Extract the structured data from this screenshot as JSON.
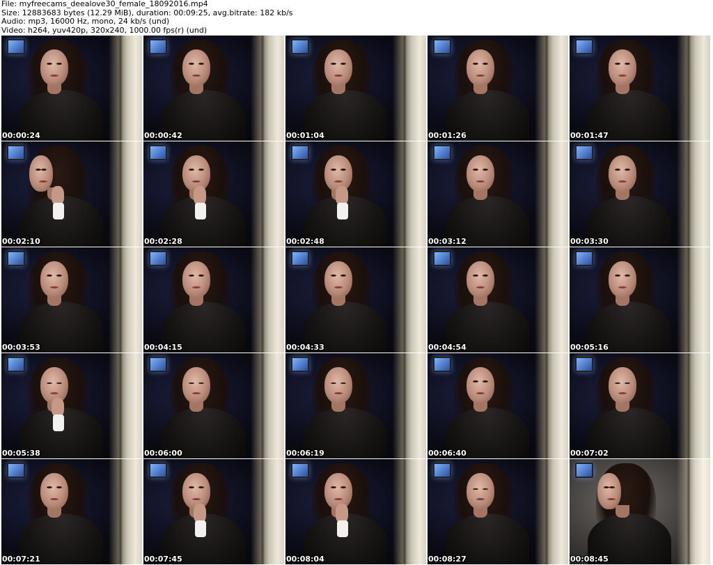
{
  "header": {
    "file": "File: myfreecams_deealove30_female_18092016.mp4",
    "size": "Size: 12883683 bytes (12.29 MiB), duration: 00:09:25, avg.bitrate: 182 kb/s",
    "audio": "Audio: mp3, 16000 Hz, mono, 24 kb/s (und)",
    "video": "Video: h264, yuv420p, 320x240, 1000.00 fps(r) (und)"
  },
  "thumbnails": [
    {
      "time": "00:00:24"
    },
    {
      "time": "00:00:42"
    },
    {
      "time": "00:01:04"
    },
    {
      "time": "00:01:26"
    },
    {
      "time": "00:01:47"
    },
    {
      "time": "00:02:10"
    },
    {
      "time": "00:02:28"
    },
    {
      "time": "00:02:48"
    },
    {
      "time": "00:03:12"
    },
    {
      "time": "00:03:30"
    },
    {
      "time": "00:03:53"
    },
    {
      "time": "00:04:15"
    },
    {
      "time": "00:04:33"
    },
    {
      "time": "00:04:54"
    },
    {
      "time": "00:05:16"
    },
    {
      "time": "00:05:38"
    },
    {
      "time": "00:06:00"
    },
    {
      "time": "00:06:19"
    },
    {
      "time": "00:06:40"
    },
    {
      "time": "00:07:02"
    },
    {
      "time": "00:07:21"
    },
    {
      "time": "00:07:45"
    },
    {
      "time": "00:08:04"
    },
    {
      "time": "00:08:27"
    },
    {
      "time": "00:08:45"
    }
  ]
}
